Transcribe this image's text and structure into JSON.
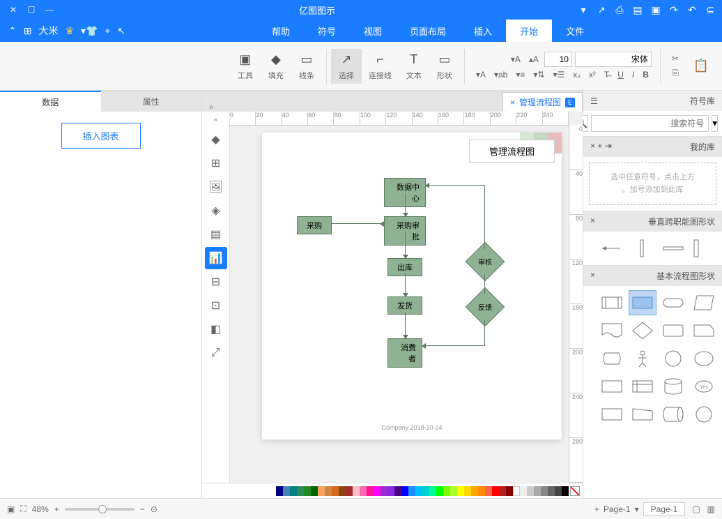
{
  "app": {
    "title": "亿图图示"
  },
  "menu": {
    "tabs": [
      "文件",
      "开始",
      "插入",
      "页面布局",
      "视图",
      "符号",
      "帮助"
    ],
    "active": 1,
    "user": "大米"
  },
  "ribbon": {
    "clipboard": [
      "剪切"
    ],
    "tools": [
      "选择",
      "连接线",
      "文本",
      "形状"
    ],
    "tools2": [
      "线条",
      "填充",
      "工具"
    ],
    "font_name": "宋体",
    "font_size": "10"
  },
  "file_tab": "管理流程图",
  "left": {
    "tabs": [
      "属性",
      "数据"
    ],
    "active": 1,
    "insert_btn": "插入图表"
  },
  "right": {
    "hdr": "符号库",
    "search_ph": "搜索符号",
    "my": "我的库",
    "my_tip1": "选中任意符号，点击上方",
    "my_tip2": "加号添加到此库。",
    "sec1": "垂直跨职能图形状",
    "sec2": "基本流程图形状"
  },
  "flow": {
    "title": "管理流程图",
    "boxes": [
      "数据中心",
      "采购",
      "采购审批",
      "出库",
      "发货",
      "消费者"
    ],
    "diamonds": [
      "审核",
      "反馈"
    ],
    "footer": "Company   2018-10-24"
  },
  "ruler_h": [
    "0",
    "20",
    "40",
    "60",
    "80",
    "100",
    "120",
    "140",
    "160",
    "180",
    "200",
    "220",
    "240"
  ],
  "status": {
    "page1": "Page-1",
    "page2": "Page-1",
    "zoom": "48%"
  }
}
